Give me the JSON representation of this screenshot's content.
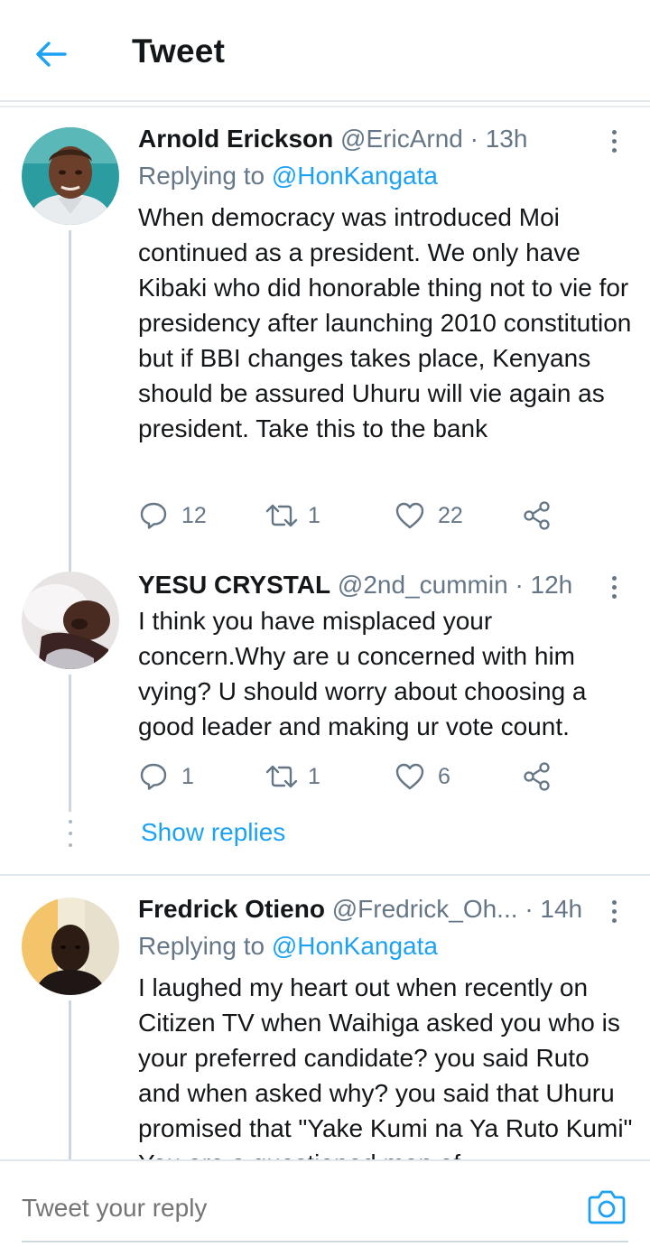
{
  "header": {
    "title": "Tweet",
    "back_icon": "arrow-left-icon",
    "accent_color": "#1da1f2"
  },
  "tweets": [
    {
      "name": "Arnold Erickson",
      "handle": "@EricArnd",
      "time": "· 13h",
      "replying_prefix": "Replying to",
      "replying_to": "@HonKangata",
      "text": "When democracy was introduced Moi continued as a president. We only have Kibaki who did honorable thing not to vie for presidency after launching 2010 constitution but if BBI changes takes place, Kenyans should be assured Uhuru will vie again as president. Take this to the bank",
      "replies": "12",
      "retweets": "1",
      "likes": "22"
    },
    {
      "name": "YESU CRYSTAL",
      "handle": "@2nd_cummin",
      "time": "· 12h",
      "text": "I think you have misplaced your concern.Why are u concerned with him vying? U should worry about choosing a good leader and making ur vote count.",
      "replies": "1",
      "retweets": "1",
      "likes": "6",
      "show_replies": "Show replies"
    },
    {
      "name": "Fredrick Otieno",
      "handle": "@Fredrick_Oh...",
      "time": "· 14h",
      "replying_prefix": "Replying to",
      "replying_to": "@HonKangata",
      "text": "I laughed my heart out when recently on Citizen TV when Waihiga asked you who is your preferred candidate? you said Ruto and when asked why? you said that Uhuru promised that \"Yake Kumi na Ya Ruto Kumi\" You are a questioned man of"
    }
  ],
  "reply_bar": {
    "placeholder": "Tweet your reply",
    "camera_icon": "camera-icon"
  }
}
